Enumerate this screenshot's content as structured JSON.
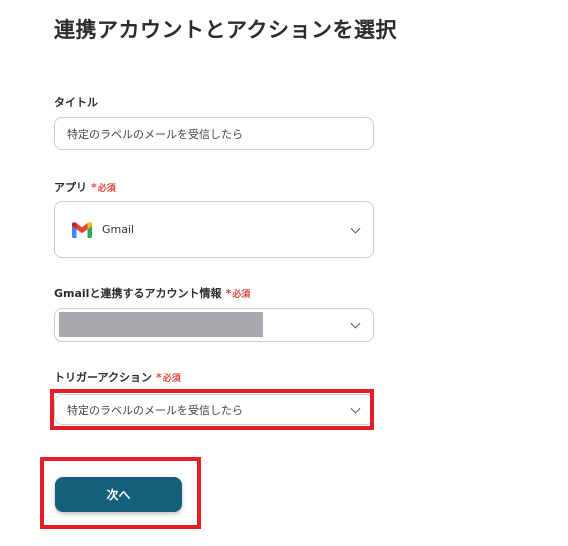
{
  "page": {
    "title": "連携アカウントとアクションを選択"
  },
  "fields": {
    "title": {
      "label": "タイトル",
      "value": "特定のラベルのメールを受信したら"
    },
    "app": {
      "label": "アプリ",
      "required": "必須",
      "value": "Gmail",
      "icon": "gmail-logo-icon"
    },
    "account": {
      "label": "Gmailと連携するアカウント情報",
      "required": "必須"
    },
    "trigger": {
      "label": "トリガーアクション",
      "required": "必須",
      "value": "特定のラベルのメールを受信したら"
    }
  },
  "buttons": {
    "next": "次へ"
  },
  "colors": {
    "accent": "#165f7a",
    "required": "#e5473d",
    "highlight": "#e31e24",
    "mask": "#a7a9ac"
  }
}
